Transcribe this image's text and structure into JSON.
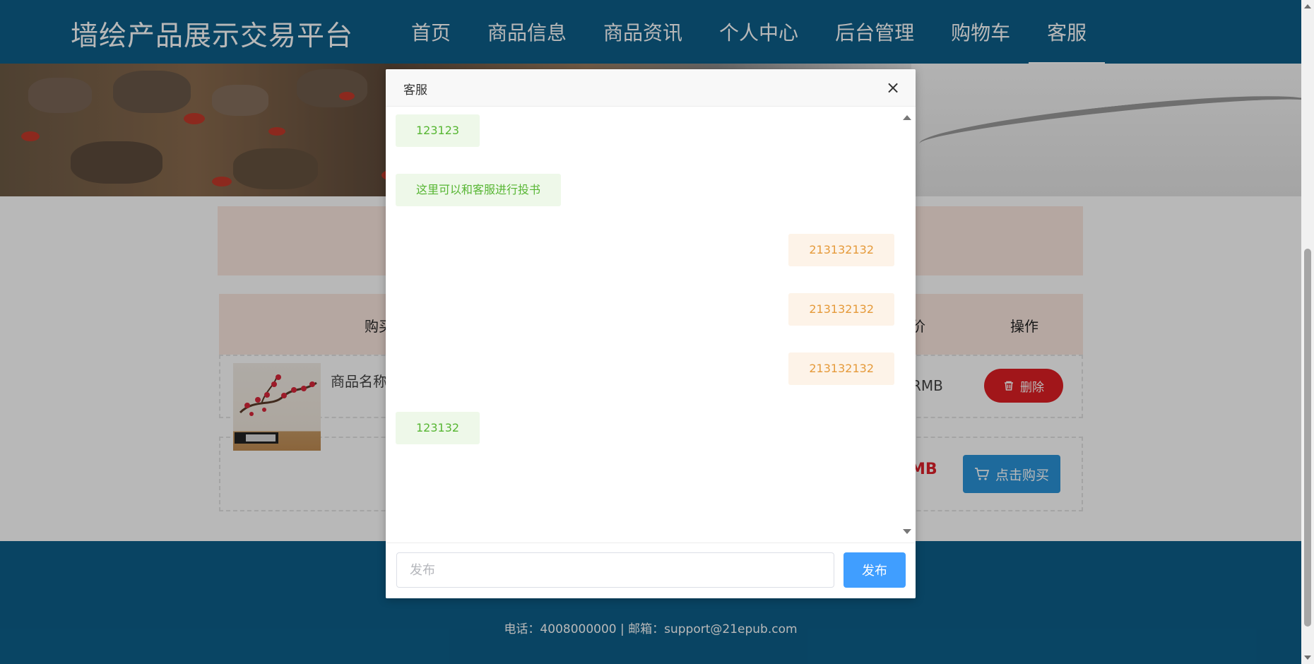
{
  "header": {
    "brand": "墙绘产品展示交易平台",
    "nav": [
      "首页",
      "商品信息",
      "商品资讯",
      "个人中心",
      "后台管理",
      "购物车",
      "客服"
    ]
  },
  "cart": {
    "col_buy_partial": "购买",
    "col_price_partial": "价",
    "col_action": "操作",
    "goods_name_partial": "商品名称",
    "price_unit_partial": "RMB",
    "delete_label": "删除",
    "total_partial": "MB",
    "buy_label": "点击购买"
  },
  "footer": {
    "contact": "电话：4008000000 | 邮箱：support@21epub.com"
  },
  "dialog": {
    "title": "客服",
    "close": "×",
    "messages": [
      {
        "side": "left",
        "text": "123123"
      },
      {
        "side": "left",
        "text": "这里可以和客服进行投书"
      },
      {
        "side": "right",
        "text": "213132132"
      },
      {
        "side": "right",
        "text": "213132132"
      },
      {
        "side": "right",
        "text": "213132132"
      },
      {
        "side": "left",
        "text": "123132"
      }
    ],
    "input_placeholder": "发布",
    "send_label": "发布"
  },
  "colors": {
    "header_bg": "#0d5f8a",
    "left_bubble_bg": "#eef8e9",
    "left_bubble_text": "#57b633",
    "right_bubble_bg": "#fdf3e8",
    "right_bubble_text": "#e59a3a",
    "send_button": "#409eff",
    "delete_button": "#e01f24",
    "buy_button": "#2a93d8"
  }
}
